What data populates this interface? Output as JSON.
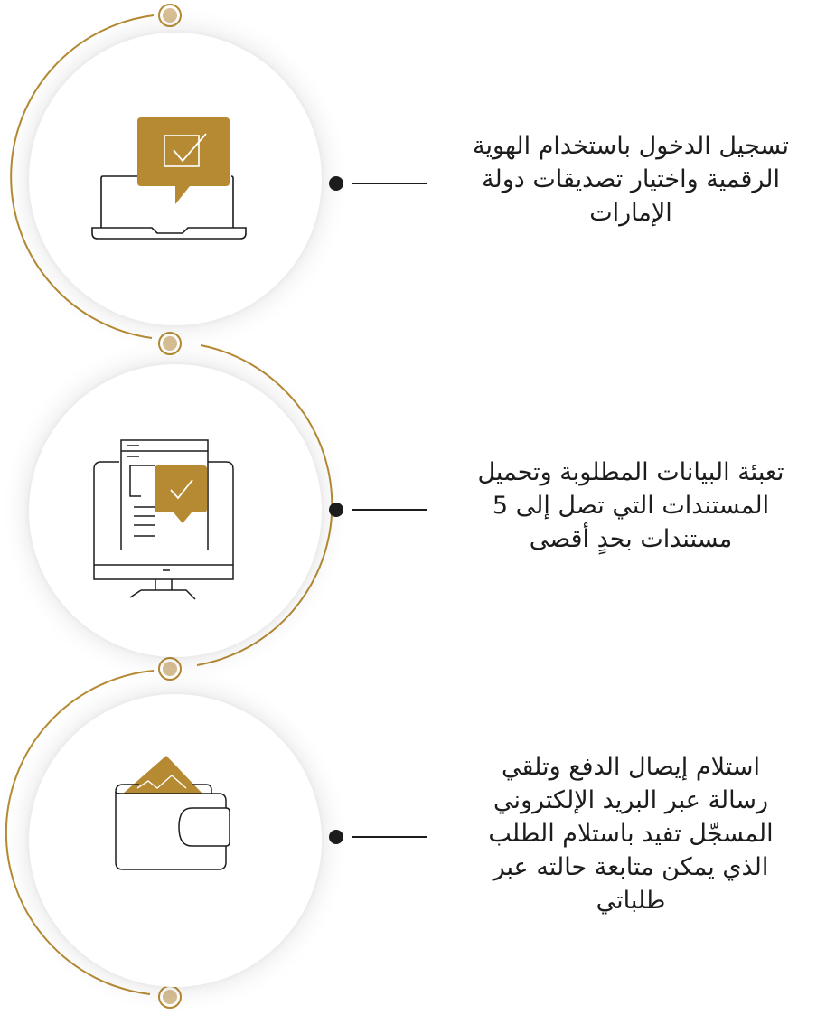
{
  "steps": [
    {
      "text": "تسجيل الدخول باستخدام الهوية\nالرقمية واختيار تصديقات دولة\nالإمارات",
      "icon": "laptop-checkmark-icon"
    },
    {
      "text": "تعبئة البيانات المطلوبة وتحميل\nالمستندات التي تصل إلى 5\nمستندات بحدٍ أقصى",
      "icon": "monitor-document-checkmark-icon"
    },
    {
      "text": "استلام إيصال الدفع وتلقي\nرسالة عبر البريد الإلكتروني\nالمسجّل تفيد باستلام الطلب\nالذي يمكن  متابعة حالته عبر\nطلباتي",
      "icon": "wallet-icon"
    }
  ],
  "colors": {
    "accent": "#B58A33",
    "node_fill": "#D8BF95",
    "text": "#1c1c1c"
  }
}
